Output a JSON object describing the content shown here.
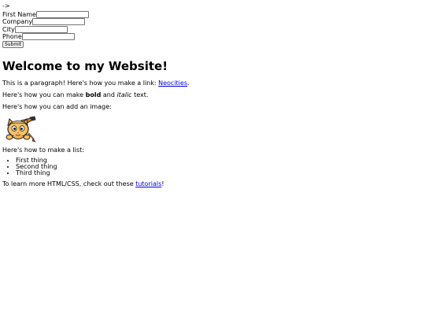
{
  "stray_text": "->",
  "form": {
    "fields": [
      {
        "label": "First Name",
        "value": ""
      },
      {
        "label": "Company",
        "value": ""
      },
      {
        "label": "City",
        "value": ""
      },
      {
        "label": "Phone",
        "value": ""
      }
    ],
    "submit_label": "Submit"
  },
  "heading": "Welcome to my Website!",
  "paragraph1": {
    "text": "This is a paragraph! Here's how you make a link: ",
    "link_text": "Neocities",
    "after": "."
  },
  "paragraph2": {
    "before": "Here's how you can make ",
    "bold": "bold",
    "middle": " and ",
    "italic": "italic",
    "after": " text."
  },
  "paragraph3": "Here's how you can add an image:",
  "image": {
    "icon": "neocities-cat-mascot-icon"
  },
  "paragraph4": "Here's how to make a list:",
  "list": [
    "First thing",
    "Second thing",
    "Third thing"
  ],
  "paragraph5": {
    "before": "To learn more HTML/CSS, check out these ",
    "link_text": "tutorials",
    "after": "!"
  }
}
